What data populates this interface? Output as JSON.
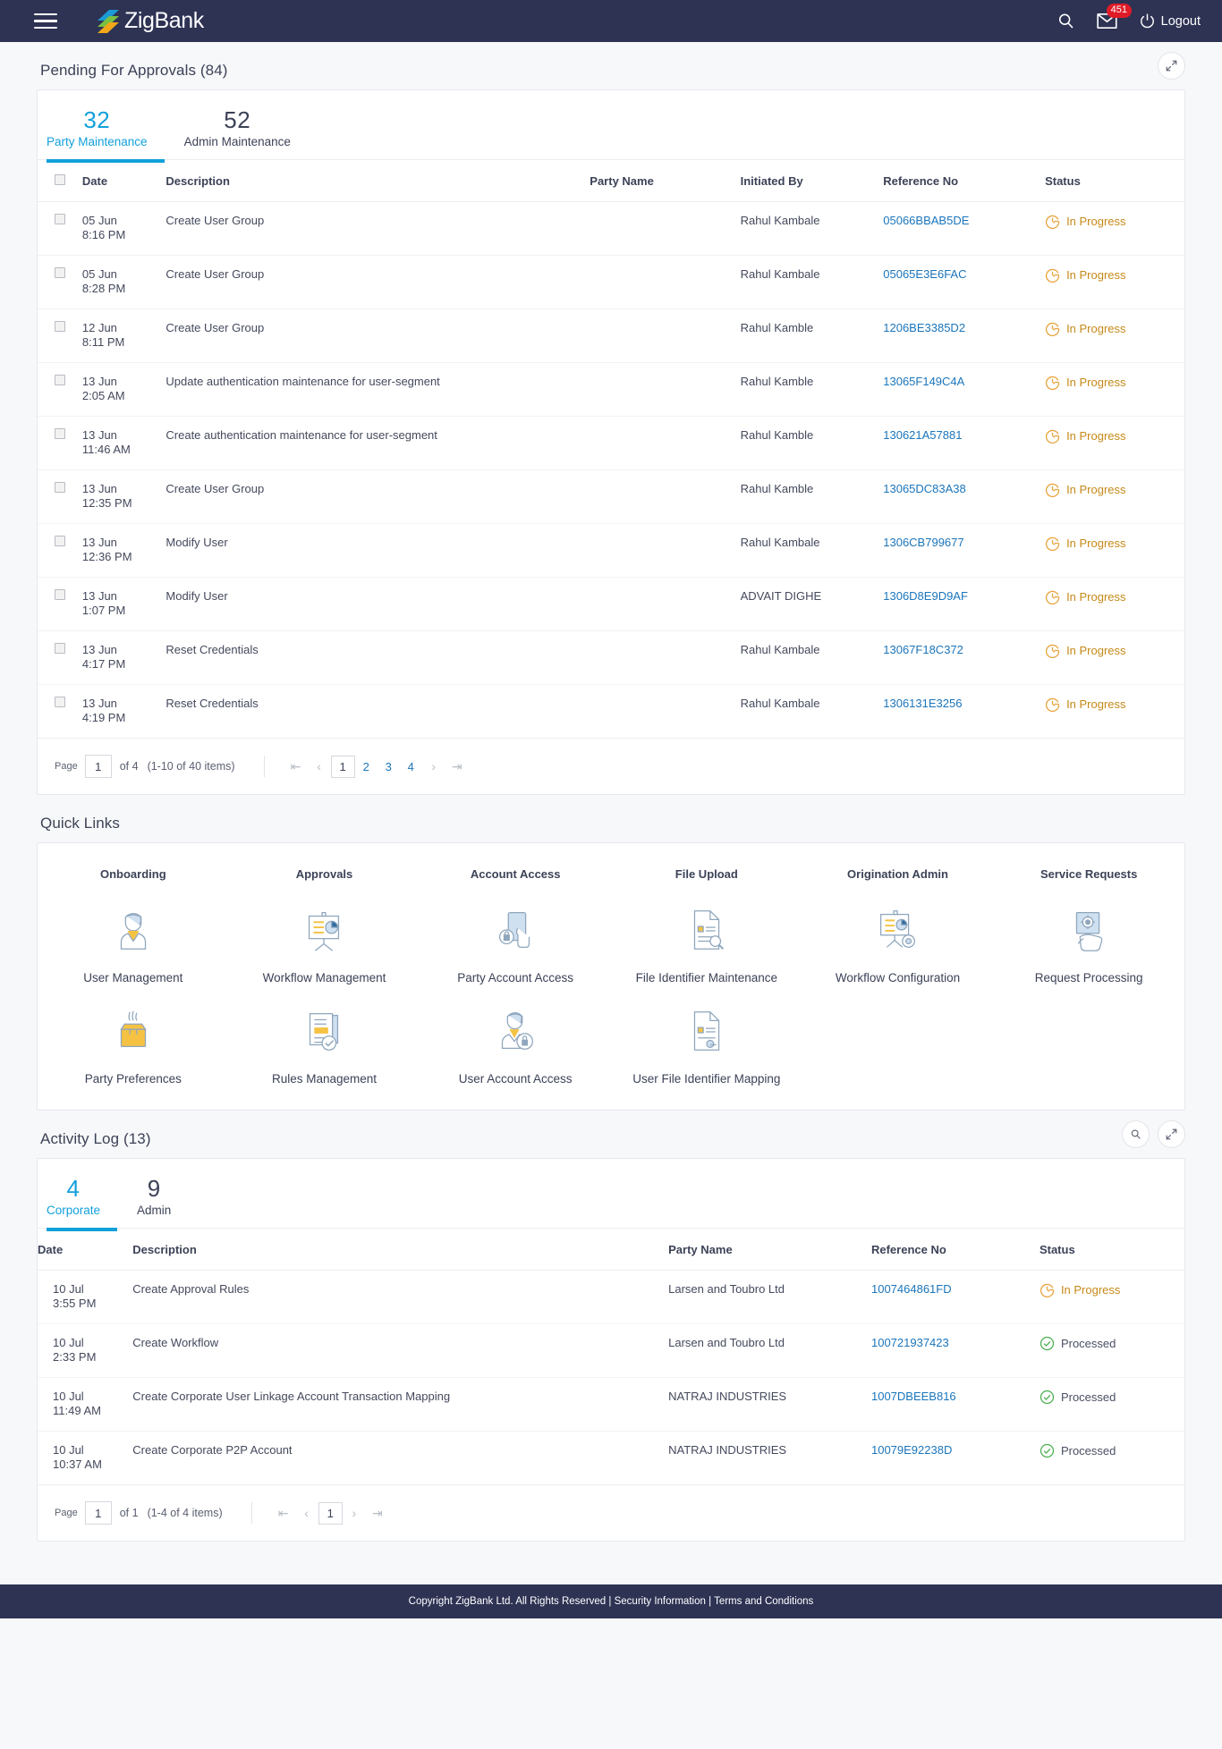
{
  "header": {
    "brand": "ZigBank",
    "menu_icon": "hamburger-icon",
    "search_icon": "search-icon",
    "mail_icon": "mail-icon",
    "mail_badge": "451",
    "power_icon": "power-icon",
    "logout_label": "Logout"
  },
  "approvals": {
    "title": "Pending For Approvals (84)",
    "expand_icon": "expand-icon",
    "tabs": [
      {
        "count": "32",
        "label": "Party Maintenance",
        "active": true
      },
      {
        "count": "52",
        "label": "Admin Maintenance",
        "active": false
      }
    ],
    "columns": [
      "Date",
      "Description",
      "Party Name",
      "Initiated By",
      "Reference No",
      "Status"
    ],
    "rows": [
      {
        "date": "05 Jun",
        "time": "8:16 PM",
        "description": "Create User Group",
        "party": "",
        "initiated_by": "Rahul Kambale",
        "reference": "05066BBAB5DE",
        "status": "In Progress",
        "status_type": "progress"
      },
      {
        "date": "05 Jun",
        "time": "8:28 PM",
        "description": "Create User Group",
        "party": "",
        "initiated_by": "Rahul Kambale",
        "reference": "05065E3E6FAC",
        "status": "In Progress",
        "status_type": "progress"
      },
      {
        "date": "12 Jun",
        "time": "8:11 PM",
        "description": "Create User Group",
        "party": "",
        "initiated_by": "Rahul Kamble",
        "reference": "1206BE3385D2",
        "status": "In Progress",
        "status_type": "progress"
      },
      {
        "date": "13 Jun",
        "time": "2:05 AM",
        "description": "Update authentication maintenance for user-segment",
        "party": "",
        "initiated_by": "Rahul Kamble",
        "reference": "13065F149C4A",
        "status": "In Progress",
        "status_type": "progress"
      },
      {
        "date": "13 Jun",
        "time": "11:46 AM",
        "description": "Create authentication maintenance for user-segment",
        "party": "",
        "initiated_by": "Rahul Kamble",
        "reference": "130621A57881",
        "status": "In Progress",
        "status_type": "progress"
      },
      {
        "date": "13 Jun",
        "time": "12:35 PM",
        "description": "Create User Group",
        "party": "",
        "initiated_by": "Rahul Kamble",
        "reference": "13065DC83A38",
        "status": "In Progress",
        "status_type": "progress"
      },
      {
        "date": "13 Jun",
        "time": "12:36 PM",
        "description": "Modify User",
        "party": "",
        "initiated_by": "Rahul Kambale",
        "reference": "1306CB799677",
        "status": "In Progress",
        "status_type": "progress"
      },
      {
        "date": "13 Jun",
        "time": "1:07 PM",
        "description": "Modify User",
        "party": "",
        "initiated_by": "ADVAIT DIGHE",
        "reference": "1306D8E9D9AF",
        "status": "In Progress",
        "status_type": "progress"
      },
      {
        "date": "13 Jun",
        "time": "4:17 PM",
        "description": "Reset Credentials",
        "party": "",
        "initiated_by": "Rahul Kambale",
        "reference": "13067F18C372",
        "status": "In Progress",
        "status_type": "progress"
      },
      {
        "date": "13 Jun",
        "time": "4:19 PM",
        "description": "Reset Credentials",
        "party": "",
        "initiated_by": "Rahul Kambale",
        "reference": "1306131E3256",
        "status": "In Progress",
        "status_type": "progress"
      }
    ],
    "pager": {
      "page_label": "Page",
      "page_value": "1",
      "of_label": "of 4",
      "count_label": "(1-10 of 40 items)",
      "first_icon": "first-page-icon",
      "prev_icon": "prev-page-icon",
      "next_icon": "next-page-icon",
      "last_icon": "last-page-icon",
      "numbers": [
        "1",
        "2",
        "3",
        "4"
      ],
      "current": "1"
    }
  },
  "quick_links": {
    "title": "Quick Links",
    "categories": [
      "Onboarding",
      "Approvals",
      "Account Access",
      "File Upload",
      "Origination Admin",
      "Service Requests"
    ],
    "items": [
      {
        "label": "User Management",
        "icon": "user-management-icon"
      },
      {
        "label": "Workflow Management",
        "icon": "workflow-management-icon"
      },
      {
        "label": "Party Account Access",
        "icon": "party-account-access-icon"
      },
      {
        "label": "File Identifier Maintenance",
        "icon": "file-identifier-maintenance-icon"
      },
      {
        "label": "Workflow Configuration",
        "icon": "workflow-configuration-icon"
      },
      {
        "label": "Request Processing",
        "icon": "request-processing-icon"
      },
      {
        "label": "Party Preferences",
        "icon": "party-preferences-icon"
      },
      {
        "label": "Rules Management",
        "icon": "rules-management-icon"
      },
      {
        "label": "User Account Access",
        "icon": "user-account-access-icon"
      },
      {
        "label": "User File Identifier Mapping",
        "icon": "user-file-identifier-mapping-icon"
      }
    ]
  },
  "activity_log": {
    "title": "Activity Log (13)",
    "search_icon": "search-icon",
    "expand_icon": "expand-icon",
    "tabs": [
      {
        "count": "4",
        "label": "Corporate",
        "active": true
      },
      {
        "count": "9",
        "label": "Admin",
        "active": false
      }
    ],
    "columns": [
      "Date",
      "Description",
      "Party Name",
      "Reference No",
      "Status"
    ],
    "rows": [
      {
        "date": "10 Jul",
        "time": "3:55 PM",
        "description": "Create Approval Rules",
        "party": "Larsen and Toubro Ltd",
        "reference": "1007464861FD",
        "status": "In Progress",
        "status_type": "progress"
      },
      {
        "date": "10 Jul",
        "time": "2:33 PM",
        "description": "Create Workflow",
        "party": "Larsen and Toubro Ltd",
        "reference": "100721937423",
        "status": "Processed",
        "status_type": "done"
      },
      {
        "date": "10 Jul",
        "time": "11:49 AM",
        "description": "Create Corporate User Linkage Account Transaction Mapping",
        "party": "NATRAJ INDUSTRIES",
        "reference": "1007DBEEB816",
        "status": "Processed",
        "status_type": "done"
      },
      {
        "date": "10 Jul",
        "time": "10:37 AM",
        "description": "Create Corporate P2P Account",
        "party": "NATRAJ INDUSTRIES",
        "reference": "10079E92238D",
        "status": "Processed",
        "status_type": "done"
      }
    ],
    "pager": {
      "page_label": "Page",
      "page_value": "1",
      "of_label": "of 1",
      "count_label": "(1-4 of 4 items)",
      "first_icon": "first-page-icon",
      "prev_icon": "prev-page-icon",
      "next_icon": "next-page-icon",
      "last_icon": "last-page-icon",
      "numbers": [
        "1"
      ],
      "current": "1"
    }
  },
  "footer": {
    "copyright": "Copyright ZigBank Ltd. All Rights Reserved",
    "sep1": "|",
    "security": "Security Information",
    "sep2": "|",
    "terms": "Terms and Conditions"
  },
  "colors": {
    "header_bg": "#2e3354",
    "accent": "#12a0db",
    "link": "#1b75bb",
    "progress": "#e8a33d",
    "processed": "#4caf50",
    "badge": "#e01b28"
  }
}
